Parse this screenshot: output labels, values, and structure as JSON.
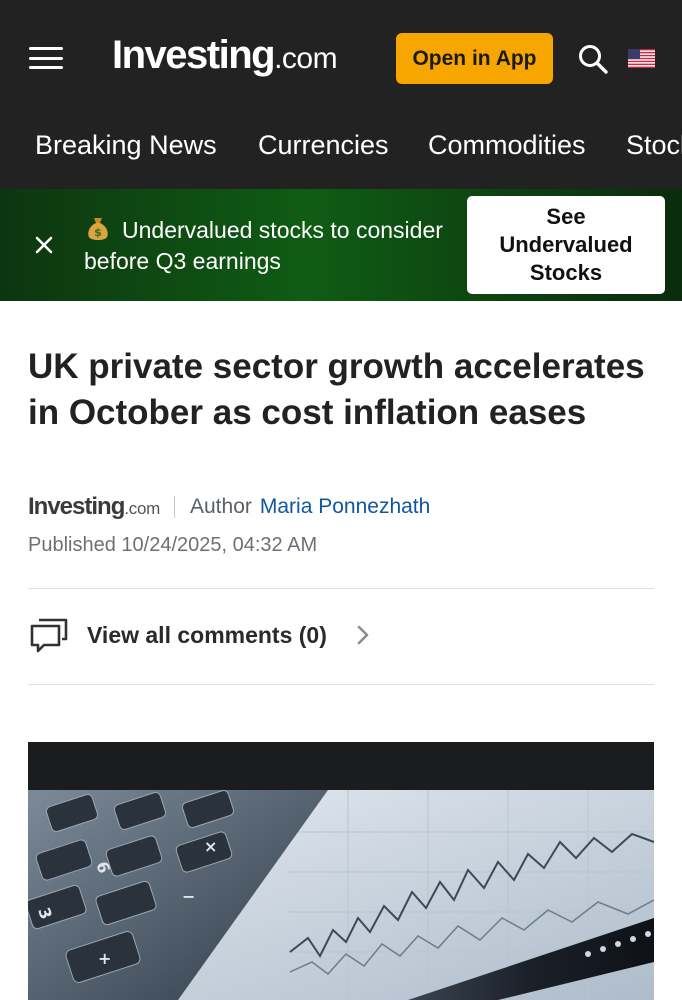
{
  "header": {
    "logo_main": "Investing",
    "logo_suffix": ".com",
    "open_app_label": "Open in App",
    "menu_icon": "hamburger-menu-icon",
    "search_icon": "search-icon",
    "flag_icon": "us-flag-icon",
    "brand_color": "#222222",
    "accent_color": "#f7a600"
  },
  "nav": {
    "items": [
      "Breaking News",
      "Currencies",
      "Commodities",
      "Stocks"
    ]
  },
  "promo": {
    "emoji_icon": "money-bag-icon",
    "text": "Undervalued stocks to consider before Q3 earnings",
    "cta_label": "See Undervalued Stocks",
    "close_icon": "close-icon"
  },
  "article": {
    "headline": "UK private sector growth accelerates in October as cost inflation eases",
    "source_main": "Investing",
    "source_suffix": ".com",
    "author_label": "Author",
    "author_name": "Maria Ponnezhath",
    "published": "Published 10/24/2025, 04:32 AM",
    "comments_label": "View all comments (0)",
    "link_color": "#1256a0"
  },
  "hero": {
    "description_icon": "calculator-chart-image"
  }
}
